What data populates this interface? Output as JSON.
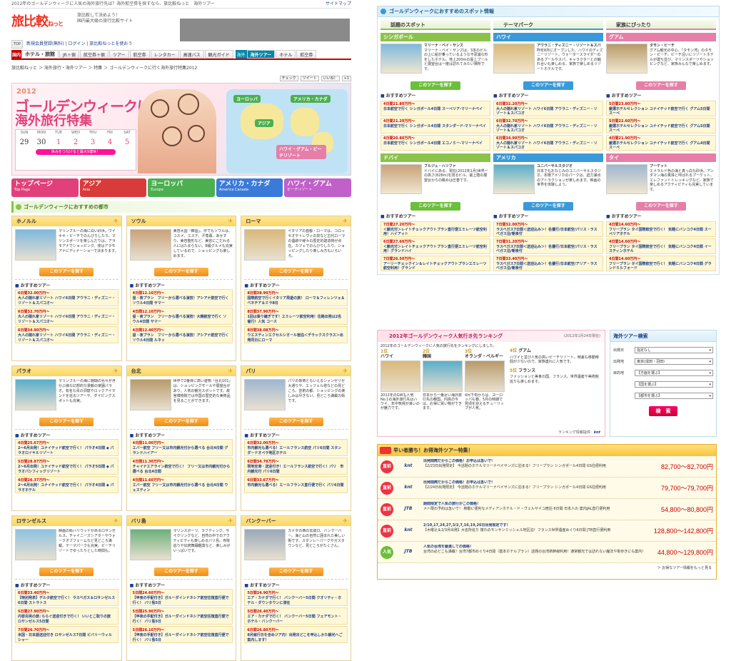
{
  "top_note": "2012年のゴールデンウィークに人気の海外旅行先は？海外航空券を探すなら、旅比較ねっと　海外ツアー",
  "top_link": "サイトマップ",
  "logo": {
    "main": "旅比較",
    "sub": "ねっと",
    "desc1": "旅比較して決めよう！",
    "desc2": "国内最大級の旅行比較サイト"
  },
  "userbar": {
    "tag": "TOP",
    "register": "新規会員登録(無料)",
    "login": "ログイン",
    "help": "旅比較ねっとを使おう"
  },
  "nav": {
    "domestic_label": "国内",
    "items": [
      "ホテル・旅館",
      "JR＋宿",
      "航空券＋宿",
      "ツアー",
      "航空券",
      "レンタカー",
      "高速バス",
      "観光ガイド"
    ],
    "overseas_label": "海外",
    "overseas_items": [
      "海外ツアー",
      "ホテル",
      "航空券"
    ]
  },
  "breadcrumb": "旅比較ねっと ＞ 海外旅行・海外ツアー ＞ 特集 ＞ ゴールデンウィークに行く海外旅行特集2012",
  "social": [
    "チェック",
    "ツイート",
    "いいね！",
    "+1"
  ],
  "hero": {
    "year": "2012",
    "title1": "ゴールデンウィークに行く",
    "title2": "海外旅行特集",
    "days": [
      "SUN",
      "MON",
      "TUE",
      "WED",
      "THU",
      "FRI",
      "SAT"
    ],
    "dates": [
      "29",
      "30",
      "1",
      "2",
      "3",
      "4",
      "5"
    ],
    "extra": "4/28",
    "rest": "休みをつなげると最大9連休！",
    "tags": [
      "ヨーロッパ",
      "アメリカ・カナダ",
      "アジア",
      "ハワイ・グアム・ビーチリゾート"
    ]
  },
  "tabs": [
    {
      "label": "トップページ",
      "sub": "Top Page"
    },
    {
      "label": "アジア",
      "sub": "Asia"
    },
    {
      "label": "ヨーロッパ",
      "sub": "Europe"
    },
    {
      "label": "アメリカ・カナダ",
      "sub": "America Canada"
    },
    {
      "label": "ハワイ・グアム",
      "sub": "ビーチリゾート"
    }
  ],
  "section_cities": "ゴールデンウィークにおすすめの都市",
  "btn_label": "このツアーを探す",
  "osusume": "おすすめツアー",
  "cities": [
    {
      "name": "ホノルル",
      "desc": "マリンブルーの海に白い砂浜。ワイキキ・ビーチでのんびりしたり、マリンスポーツを楽しんだりは、アラモアナでショッピング。夜はアラモアナにディナーショーで決まります。",
      "tours": [
        [
          "6日間32.00万円〜",
          "大人の隠れ家リゾート ハワイ6日間 アウラニ・ディズニー・リゾート＆スパコオ〜"
        ],
        [
          "6日間32.70万円〜",
          "大人の隠れ家リゾート ハワイ6日間 アウラニ・ディズニー・リゾート＆スパコオ〜"
        ],
        [
          "6日間34.90万円〜",
          "大人の隠れ家リゾート ハワイ6日間 アウラニ・ディズニー・リゾート＆スパコオ〜"
        ]
      ]
    },
    {
      "name": "ソウル",
      "desc": "美容大国「韓国」。中でもソウルは、コスメ、エステ、汗蒸幕、あかすり、美容整形など、美容にこだわる人にはたまらない。B級グルメも充実しているので、ショッピングも楽しめます。",
      "tours": [
        [
          "4日間12.10万円〜",
          "昼・夜プラン　フリーから選べる演技！アシアナ航空で行く ソウル4日間 サマー"
        ],
        [
          "4日間12.10万円〜",
          "昼・夜プラン　フリーから選べる演技！大韓航空で行く ソウル4日間 サマー"
        ],
        [
          "4日間12.40万円〜",
          "昼・夜プラン　フリーから選べる演技！アシアナ航空で行く ソウル4日間 ルネッ"
        ]
      ]
    },
    {
      "name": "ローマ",
      "desc": "イタリアの首都・ローマは、コロッセオやトレヴィの泉など古代ローマの遺跡や様々の歴史的建造物が点在。カフェでのんびりしたり、ショッピングしたり楽しみ方もいろいろ。",
      "tours": [
        [
          "8日間38.90万円〜",
          "国際航空で行くイタリア周遊の旅！ ローマ＆フィレンツェ＆ベネチア＆ミラ8日"
        ],
        [
          "8日間37.90万円〜",
          "1回は乗り継ぎです！エミレーツ航空利用！往路出発は2名催行！人気 コース"
        ],
        [
          "8日間38.08万円〜",
          "ウエスティンエクセルシオール宿泊＜デラックスクラス＞出発同日にローマ"
        ]
      ]
    },
    {
      "name": "パラオ",
      "desc": "マリンブルーの海に珊瑚の島々が浮かぶ様な幻想的な景観の楽園パラオ。有名な青の洞窟やロックアイランドを巡るツアーや、ダイビングスポットも充実。",
      "tours": [
        [
          "4日間25.67万円〜",
          "2〜6月出発！ユナイテッド航空で行く！ パラオ4日間 ◆ パラオロイヤルリゾート"
        ],
        [
          "5日間28.87万円〜",
          "2〜6月出発！ユナイテッド航空で行く！ パラオ5日間 ◆ パラオパシフィックリゾート"
        ],
        [
          "4日間26.37万円〜",
          "2〜6月出発！ユナイテッド航空で行く！ パラオ4日間 ◆ パラオホテル"
        ]
      ]
    },
    {
      "name": "台北",
      "desc": "世界で2番目に高い建物「台北101」は、ショッピングモールや展望台があり、人気の観光スポットです。故宮博物院では中国の歴史的な美術品を見ることができます。",
      "tours": [
        [
          "4日間11.00万円〜",
          "エバー航空 フリー又は市内観光付から選べる 台北4日間 グランドハイアー"
        ],
        [
          "4日間11.30万円〜",
          "チャイナエアライン航空で行く！ フリー又は市内観光付から選べる 台北4日間"
        ],
        [
          "4日間11.60万円〜",
          "エバー航空 フリー又は市内観光付から選べる 台北4日間 ウェスティン"
        ]
      ]
    },
    {
      "name": "パリ",
      "desc": "パリの象徴ともいえるシャンゼリゼ大通りや、エッフェル塔などの見どころ。芸術の都、ショッピングの楽しみは尽きない、見どころ満載の街です。",
      "tours": [
        [
          "6日間32.00万円〜",
          "市内観光も選べる！エールフランス航空 パリ6日間 スタンダードオペラ地区ホテル"
        ],
        [
          "6日間34.78万円〜",
          "現地空港・送迎付き！エールフランス航空で行く！パリ　市内観光付 パリ6日間"
        ],
        [
          "6日間33.67万円〜",
          "市内観光も選べる！エールフランス直行便で行く パリ6日間"
        ]
      ]
    },
    {
      "name": "ロサンゼルス",
      "desc": "映画の街ハリウッドがあるロサンゼルス。チャイニーズシアターやウォークオブフェームなど見どころ満載。テーマパークも充実。ビーチリゾートでゆったりとした時間も。",
      "tours": [
        [
          "6日間33.40万円〜",
          "【特別発表】デルタ航空で行く！ ラスベガス＆ロサンゼルス6日間 ストラトス"
        ],
        [
          "5日間27.90万円〜",
          "内容充実の旅♪ららぐ送迎付きで行く！ いいとこ取りの旅 ロサンゼルス5日間"
        ],
        [
          "7日間26.70万円〜",
          "米国・日本語送迎付き ロサンゼルス7日間 ビバリーウィルシャー"
        ]
      ]
    },
    {
      "name": "バリ島",
      "desc": "マリンスポーツ、ラフティング、サイクリングなど、自然の中でのアクティビティも楽しめるバリ島。寺院巡りや伝統舞踊鑑賞など、楽しみがいっぱいです。",
      "tours": [
        [
          "5日間24.60万円〜",
          "【甲夜の手配付き】ガルーダインドネシア航空往復直行便で行く！ バリ島5日"
        ],
        [
          "5日間25.90万円〜",
          "【甲夜の手配付き】ガルーダインドネシア航空往復直行便で行く！ バリ島5日"
        ],
        [
          "5日間26.10万円〜",
          "【甲夜の手配付き】ガルーダインドネシア航空往復直行便で行く！ バリ島5日"
        ]
      ]
    },
    {
      "name": "バンクーバー",
      "desc": "カナダの西の玄関口、バンクーバー。海と山の自然に囲まれた美しい街です。スタンレーパークやガスタウンなど、見どころがたくさん。",
      "tours": [
        [
          "5日間24.90万円〜",
          "エア・カナダで行く！ バンクーバー5日間 クオリティ・ホテル・ダウンタウンに滞在"
        ],
        [
          "5日間26.40万円〜",
          "エア・カナダで行く！ バンクーバー5日間 フェアモント・ホテル・バンクーバー"
        ],
        [
          "6日間26.80万円〜",
          "8月催行日を含めジア内！出発日どこを申込しかた観光へご案内します！"
        ]
      ]
    }
  ],
  "spots_title": "ゴールデンウィークにおすすめのスポット情報",
  "spot_cols": [
    {
      "head": "話題のスポット",
      "color": "#8bc34a",
      "items": [
        {
          "dest": "シンガポール",
          "title": "マリーナ・ベイ・サンズ",
          "desc": "マリーナ・ベイ・サンズは、3本のビルの上に船が乗っているような不思議な形をしたホテル。地上200mの屋上プールと展望台は一度は訪れてみたい場所です。",
          "tours": [
            [
              "4日間21.80万円〜",
              "日本航空で行く シンガポール4日間 スーペリア-マリーナベイ"
            ],
            [
              "4日間21.20万円〜",
              "日本航空で行く シンガポール4日間 スタンダード-マリーナベイ"
            ],
            [
              "4日間20.80万円〜",
              "日本航空で行く シンガポール4日間 エコノミー-マリーナベイ"
            ]
          ]
        },
        {
          "dest": "ドバイ",
          "title": "ブルジュ・ハリファ",
          "desc": "ドバイにある、現在(2012年1月)世界一の高さ(828m)を誇るビル。最上階の展望台からの眺めは圧巻です。",
          "tours": [
            [
              "7日間27.20万円〜",
              "＜観光付＞レイトチェックアウトプラン直行便エミレーツ航空利用！ハイアット"
            ],
            [
              "6日間27.60万円〜",
              "＜観光付＞レイトチェックアウトプラン直行便エミレーツ航空利用！グランドハイ"
            ],
            [
              "7日間26.50万円〜",
              "アーリーチェックイン＆レイトチェックアウトプランエミレーツ航空利用！グランド"
            ]
          ]
        }
      ]
    },
    {
      "head": "テーマパーク",
      "color": "#3a9ad9",
      "items": [
        {
          "dest": "ハワイ",
          "title": "アウラニ・ディズニー・リゾート＆スパ",
          "desc": "昨年8月にオープンした、ハワイのディズニーリゾート。ウォータースライダーのあるプールやスパ、キャラクターとの触れ合いも楽しめる、家族で楽しめるリゾートホテルです。",
          "tours": [
            [
              "6日間32.20万円〜",
              "大人の隠れ家リゾート ハワイ6日間 アウラニ・ディズニー・リゾート＆スパコオ"
            ],
            [
              "6日間32.70万円〜",
              "大人の隠れ家リゾート ハワイ6日間 アウラニ・ディズニー・リゾート＆スパコオ"
            ],
            [
              "6日間34.90万円〜",
              "大人の隠れ家リゾート ハワイ6日間 アウラニ・ディズニー・リゾート＆スパコオ"
            ]
          ]
        },
        {
          "dest": "アメリカ",
          "title": "ユニバーサルスタジオ",
          "desc": "日本でもおなじみのユニバーサルスタジオ。本場アメリカのパークは、迫力満点のアトラクションが楽しめます。映画の世界を体験しよう。",
          "tours": [
            [
              "7日間32.00万円〜",
              "ラスベガス7日間＜送迎込み＞！名優行/日本航空/パリス・ラスベガス泊/朝食付"
            ],
            [
              "7日間31.20万円〜",
              "ラスベガス7日間＜送迎込み＞！名優行/日本航空/パリス・ラスベガス泊/朝食付"
            ],
            [
              "7日間33.40万円〜",
              "ラスベガス7日間＜送迎込み＞！名優行/日本航空/アリア・ラスベガス泊/朝食付"
            ]
          ]
        }
      ]
    },
    {
      "head": "家族にぴったり",
      "color": "#e57fa8",
      "items": [
        {
          "dest": "グアム",
          "title": "タモン・ビーチ",
          "desc": "グアム観光の中心、「タモン湾」のタモン・ビーチ。ビーチ沿いにリゾートホテルが建ち並び、マリンスポーツやショッピングなど、家族みんなで楽しめます。",
          "tours": [
            [
              "5日間23.80万円〜",
              "厳選ホテルセレクション ユナイテッド航空で行く グアム5日間 スーペ"
            ],
            [
              "5日間22.60万円〜",
              "厳選ホテルセレクション ユナイテッド航空で行く グアム5日間 スーペ"
            ],
            [
              "4日間21.90万円〜",
              "厳選ホテルセレクション ユナイテッド航空で行く グアム4日間 スーペ"
            ]
          ]
        },
        {
          "dest": "タイ",
          "title": "プーケット",
          "desc": "エメラルド色の海と真っ白な砂浜。アンダマン海の真珠と呼ばれるプーケット。エレファントトレッキングなど、家族で楽しめるアクティビティも充実しています。",
          "tours": [
            [
              "4日間14.60万円〜",
              "フリープラン タイ国際航空で行く！ 気軽にバンコク4日間 スーペリアホテル"
            ],
            [
              "4日間14.60万円〜",
              "フリープラン タイ国際航空で行く！ 気軽にバンコク4日間 イースティンホテル"
            ],
            [
              "4日間14.60万円〜",
              "フリープラン タイ国際航空で行く！ 気軽にバンコク4日間 グランドミルフォード"
            ]
          ]
        }
      ]
    }
  ],
  "spot_btn_colors": [
    "#6cbf3a",
    "#3a9ad9",
    "#e57fa8"
  ],
  "ranking": {
    "title": "2012年ゴールデンウィーク人気行き先ランキング",
    "date": "(2012年1月24日現在)",
    "intro": "2012年のゴールデンウィークに人気の旅行先をランキングにしました。",
    "items": [
      {
        "rank": "1位",
        "name": "ハワイ",
        "desc": "2012年のGWも人気No.1の海外旅行先はハワイ。年中気候が良いのが魅力です。"
      },
      {
        "rank": "2位",
        "name": "韓国",
        "desc": "日本から一番近い海外旅行先の韓国。円高の今は、お得に買い物ができます。"
      },
      {
        "rank": "3位",
        "name": "オランダ・ベルギー",
        "desc": "4月下旬からは、ヨーロッパも春。5月の時期で見頃を迎えるチューリップが人気。"
      }
    ],
    "side": [
      {
        "rank": "4位",
        "name": "グアム",
        "desc": "ハワイと並び人気の高いビーチリゾート。時差も移動時間が少ないので、家族連れに人気です。"
      },
      {
        "rank": "5位",
        "name": "フランス",
        "desc": "ファッションと美食の国、フランス。世界遺産や美術館巡りも楽しめます。"
      }
    ],
    "source": "ランキング情報提供："
  },
  "search": {
    "title": "海外ツアー検索",
    "rows": [
      {
        "label": "出発日",
        "value": "指定なし"
      },
      {
        "label": "出発地",
        "value": "東京(成田・羽田)"
      },
      {
        "label": "目的地",
        "value": "【方面を選ぶ】"
      },
      {
        "label": "",
        "value": "【国を選ぶ】"
      },
      {
        "label": "",
        "value": "【都市を選ぶ】"
      }
    ],
    "button": "検　索"
  },
  "deals": {
    "title": "早い者勝ち！お得海外ツアー特集！",
    "badge": "お得",
    "items": [
      {
        "icon": "直前",
        "brand": "knt",
        "title": "出発間際だからこの価格！お申込は急いで！",
        "text": "【2/23日出発限定】 今話題のホテルマリーナベイサンズに泊まる！フリープラン シンガポール4日間 GS往便利用",
        "price": "82,700〜82,700円"
      },
      {
        "icon": "直前",
        "brand": "knt",
        "title": "出発間際だからこの価格！お申込は急いで！",
        "text": "【2/24日出発限定】 今話題のホテルマリーナベイサンズに泊まる！フリープラン シンガポール4日間 GS往便利用",
        "price": "79,700〜79,700円"
      },
      {
        "icon": "直前",
        "brand": "JTB",
        "title": "期間限定で人気の旅行がこの価格！",
        "text": "メト限の予約は急いで！ 移動に便利なメディアンホテル・ド・ヴェルサイユ宿泊 6日間 日本人の 案内JAL直行便利用",
        "price": "54,800〜80,800円"
      },
      {
        "icon": "直前",
        "brand": "knt",
        "title": "2/10,17,24,27,3/2,7,16,19,26日出発限定です！",
        "text": "【木曜込＆2/3月出発】大名所巡り 憧れのモンサンミッシェル地区泊！フランス世界遺産めぐり6日間 JTB直行便利用",
        "price": "128,800〜142,800円"
      },
      {
        "icon": "人気",
        "brand": "JTB",
        "title": "人気の台湾を厳選しての価格！",
        "text": "台湾の必どこも満載！台湾7都市めぐり4日間（基本ホテルプラン）話題の台湾新幹線利用！通常観光では訪れない魔法や街歩きにも案内！",
        "price": "44,800〜129,800円"
      }
    ],
    "more": "お得なツアー情報をもっと見る"
  }
}
